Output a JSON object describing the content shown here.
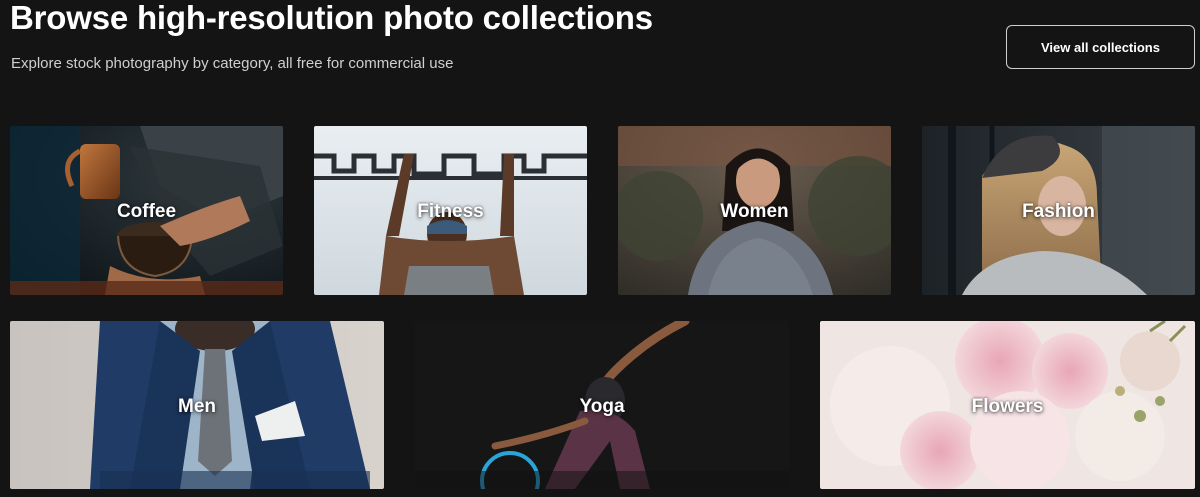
{
  "header": {
    "title": "Browse high-resolution photo collections",
    "subtitle": "Explore stock photography by category, all free for commercial use",
    "view_all_label": "View all collections"
  },
  "collections": [
    {
      "label": "Coffee"
    },
    {
      "label": "Fitness"
    },
    {
      "label": "Women"
    },
    {
      "label": "Fashion"
    },
    {
      "label": "Men"
    },
    {
      "label": "Yoga"
    },
    {
      "label": "Flowers"
    }
  ],
  "colors": {
    "background": "#141414",
    "text": "#ffffff",
    "subtitle": "#cfcfcf",
    "button_border": "#cfcfcf"
  }
}
